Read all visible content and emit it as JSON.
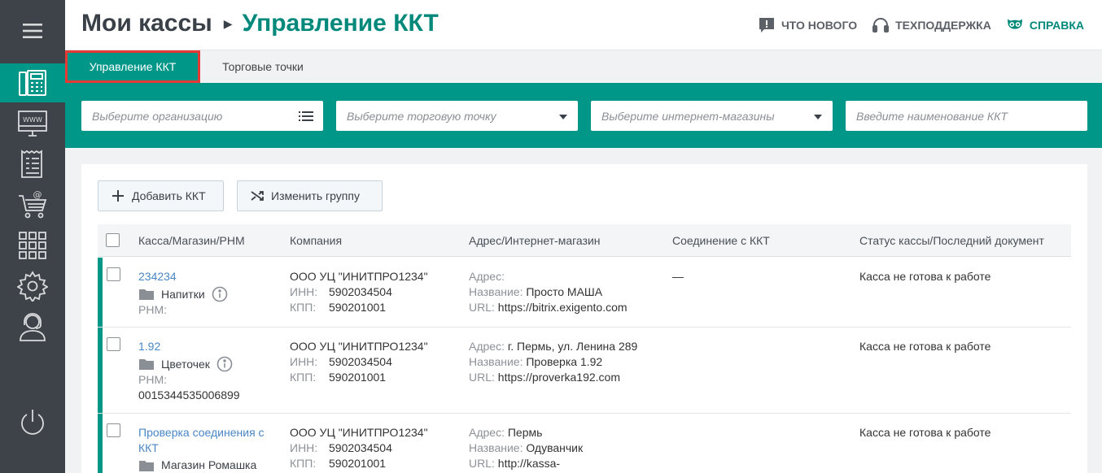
{
  "header": {
    "crumb_root": "Мои кассы",
    "crumb_current": "Управление ККТ",
    "links": {
      "whats_new": "ЧТО НОВОГО",
      "support": "ТЕХПОДДЕРЖКА",
      "help": "СПРАВКА"
    }
  },
  "tabs": {
    "active": "Управление ККТ",
    "second": "Торговые точки"
  },
  "filters": {
    "organization": "Выберите организацию",
    "point": "Выберите торговую точку",
    "shops": "Выберите интернет-магазины",
    "kkt_name": "Введите наименование ККТ"
  },
  "toolbar": {
    "add": "Добавить ККТ",
    "change_group": "Изменить группу"
  },
  "table": {
    "columns": [
      "Касса/Магазин/РНМ",
      "Компания",
      "Адрес/Интернет-магазин",
      "Соединение с ККТ",
      "Статус кассы/Последний документ"
    ],
    "labels": {
      "rnm": "РНМ:",
      "inn": "ИНН:",
      "kpp": "КПП:",
      "address": "Адрес:",
      "name": "Название:",
      "url": "URL:"
    },
    "rows": [
      {
        "kkt": "234234",
        "shop": "Напитки",
        "rnm": "",
        "company": "ООО УЦ \"ИНИТПРО1234\"",
        "inn": "5902034504",
        "kpp": "590201001",
        "address": "",
        "name": "Просто МАША",
        "url": "https://bitrix.exigento.com",
        "connection": "—",
        "status": "Касса не готова к работе"
      },
      {
        "kkt": "1.92",
        "shop": "Цветочек",
        "rnm": "0015344535006899",
        "company": "ООО УЦ \"ИНИТПРО1234\"",
        "inn": "5902034504",
        "kpp": "590201001",
        "address": "г. Пермь, ул. Ленина 289",
        "name": "Проверка 1.92",
        "url": "https://proverka192.com",
        "connection": "",
        "status": "Касса не готова к работе"
      },
      {
        "kkt": "Проверка соединения с ККТ",
        "shop": "Магазин Ромашка",
        "rnm": "",
        "company": "ООО УЦ \"ИНИТПРО1234\"",
        "inn": "5902034504",
        "kpp": "590201001",
        "address": "Пермь",
        "name": "Одуванчик",
        "url": "http://kassa-",
        "connection": "",
        "status": "Касса не готова к работе"
      }
    ]
  },
  "colors": {
    "accent": "#009688",
    "sidebar": "#3d4349",
    "link": "#4a86c5",
    "highlight": "#e53935"
  }
}
